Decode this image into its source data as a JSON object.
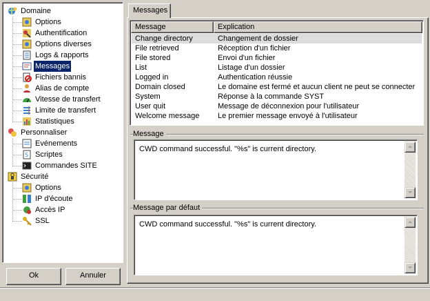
{
  "tree": {
    "domain": {
      "label": "Domaine",
      "children": [
        "Options",
        "Authentification",
        "Options diverses",
        "Logs & rapports",
        "Messages",
        "Fichiers bannis",
        "Alias de compte",
        "Vitesse de transfert",
        "Limite de transfert",
        "Statistiques"
      ],
      "selected": "Messages"
    },
    "personnaliser": {
      "label": "Personnaliser",
      "children": [
        "Evénements",
        "Scriptes",
        "Commandes SITE"
      ]
    },
    "securite": {
      "label": "Sécurité",
      "children": [
        "Options",
        "IP d'écoute",
        "Accès IP",
        "SSL"
      ]
    }
  },
  "buttons": {
    "ok": "Ok",
    "cancel": "Annuler"
  },
  "tab": {
    "label": "Messages"
  },
  "list": {
    "headers": [
      "Message",
      "Explication"
    ],
    "rows": [
      [
        "Change directory",
        "Changement de dossier"
      ],
      [
        "File retrieved",
        "Réception d'un fichier"
      ],
      [
        "File stored",
        "Envoi d'un fichier"
      ],
      [
        "List",
        "Listage d'un dossier"
      ],
      [
        "Logged in",
        "Authentication réussie"
      ],
      [
        "Domain closed",
        "Le domaine est fermé et aucun client ne peut se connecter"
      ],
      [
        "System",
        "Réponse à la commande SYST"
      ],
      [
        "User quit",
        "Message de déconnexion pour l'utilisateur"
      ],
      [
        "Welcome message",
        "Le premier message envoyé à l'utilisateur"
      ]
    ],
    "selected_index": 0
  },
  "message_group": {
    "label": "Message",
    "value": "CWD command successful. \"%s\" is current directory."
  },
  "default_group": {
    "label": "Message par défaut",
    "value": "CWD command successful. \"%s\" is current directory."
  },
  "icons": {
    "domain": "globe-users-icon",
    "options": "options-gear-icon",
    "auth": "key-user-icon",
    "misc": "options-gear-icon",
    "logs": "notebook-icon",
    "messages": "message-card-icon",
    "banned": "banned-file-icon",
    "alias": "user-alias-icon",
    "speed": "speed-gauge-icon",
    "limit": "limit-list-icon",
    "stats": "statistics-icon",
    "personnaliser": "customize-folder-icon",
    "events": "events-window-icon",
    "scripts": "script-page-icon",
    "site": "console-icon",
    "securite": "padlock-icon",
    "sec_options": "options-gear-icon",
    "listen_ip": "network-ip-icon",
    "ip_access": "ip-access-icon",
    "ssl": "ssl-key-icon"
  }
}
